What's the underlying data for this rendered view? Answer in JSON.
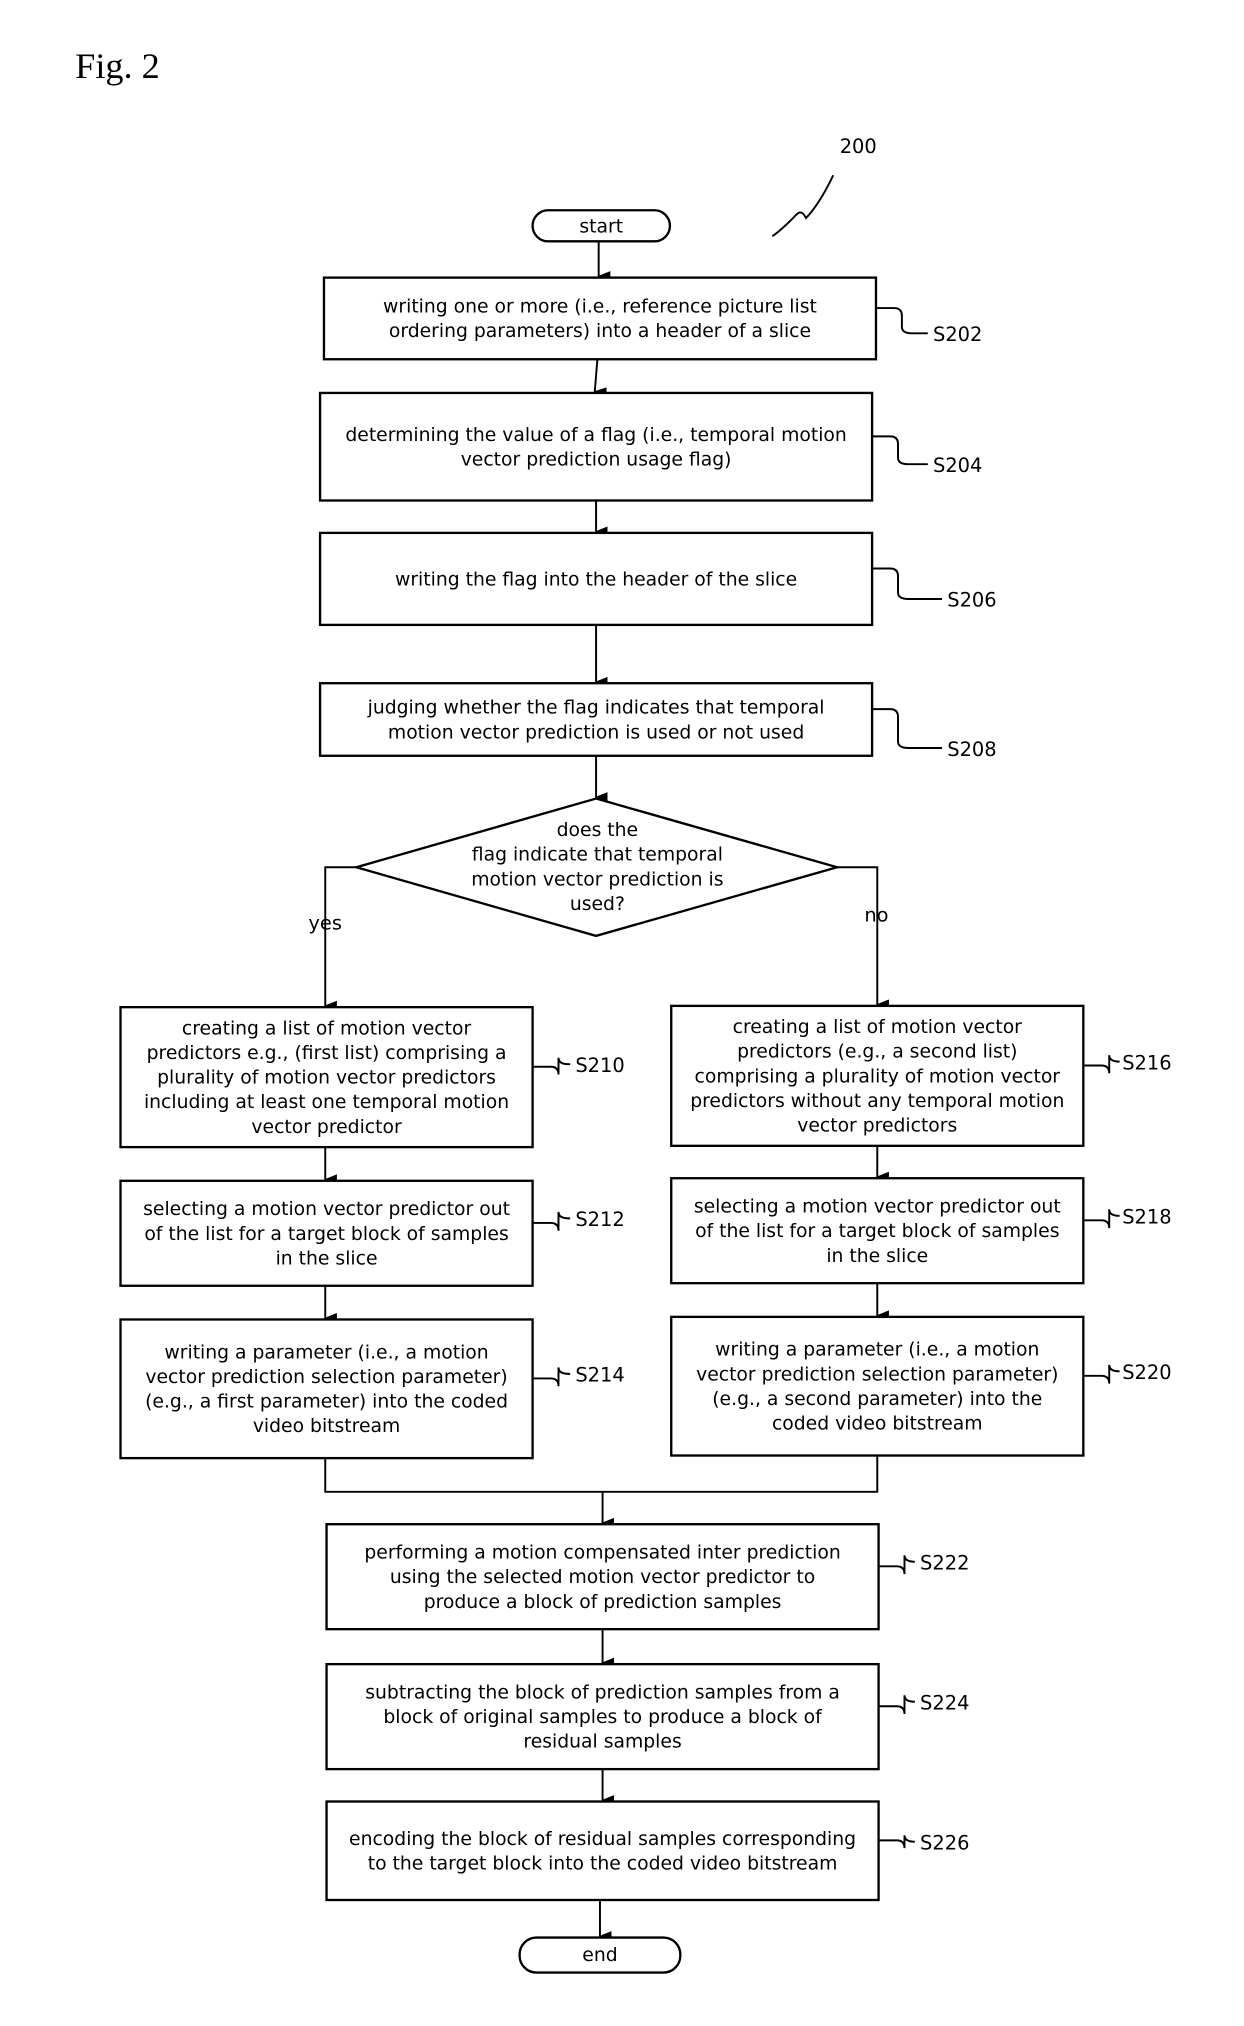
{
  "figure": {
    "title": "Fig. 2",
    "reference_number": "200"
  },
  "terminals": {
    "start": "start",
    "end": "end"
  },
  "steps": {
    "S202": {
      "id": "S202",
      "lines": [
        "writing one or more (i.e., reference picture list",
        "ordering parameters) into a header of a slice"
      ]
    },
    "S204": {
      "id": "S204",
      "lines": [
        "determining the value of a flag (i.e., temporal motion",
        "vector prediction usage flag)"
      ]
    },
    "S206": {
      "id": "S206",
      "lines": [
        "writing the flag into the header of the slice"
      ]
    },
    "S208": {
      "id": "S208",
      "lines": [
        "judging whether the flag indicates that temporal",
        "motion vector prediction is used or not used"
      ]
    },
    "S210": {
      "id": "S210",
      "lines": [
        "creating a list of motion vector",
        "predictors e.g., (first list) comprising a",
        "plurality of motion vector predictors",
        "including at least one temporal motion",
        "vector predictor"
      ]
    },
    "S212": {
      "id": "S212",
      "lines": [
        "selecting a motion vector predictor out",
        "of the list for a target block of samples",
        "in the slice"
      ]
    },
    "S214": {
      "id": "S214",
      "lines": [
        "writing a parameter (i.e., a motion",
        "vector prediction selection parameter)",
        "(e.g., a first parameter) into the coded",
        "video bitstream"
      ]
    },
    "S216": {
      "id": "S216",
      "lines": [
        "creating a list of motion vector",
        "predictors (e.g., a second list)",
        "comprising a plurality of motion vector",
        "predictors without any temporal motion",
        "vector predictors"
      ]
    },
    "S218": {
      "id": "S218",
      "lines": [
        "selecting a motion vector predictor out",
        "of the list for a target block of samples",
        "in the slice"
      ]
    },
    "S220": {
      "id": "S220",
      "lines": [
        "writing a parameter (i.e., a motion",
        "vector prediction selection parameter)",
        "(e.g., a second parameter) into the",
        "coded video bitstream"
      ]
    },
    "S222": {
      "id": "S222",
      "lines": [
        "performing a motion compensated inter prediction",
        "using the selected motion vector predictor to",
        "produce a block of prediction samples"
      ]
    },
    "S224": {
      "id": "S224",
      "lines": [
        "subtracting the block of prediction samples from a",
        "block of original samples to produce a block of",
        "residual samples"
      ]
    },
    "S226": {
      "id": "S226",
      "lines": [
        "encoding the block of residual samples corresponding",
        "to the target block into the coded video bitstream"
      ]
    }
  },
  "decision": {
    "lines": [
      "does the",
      "flag indicate that temporal",
      "motion vector prediction is",
      "used?"
    ],
    "yes_label": "yes",
    "no_label": "no"
  }
}
